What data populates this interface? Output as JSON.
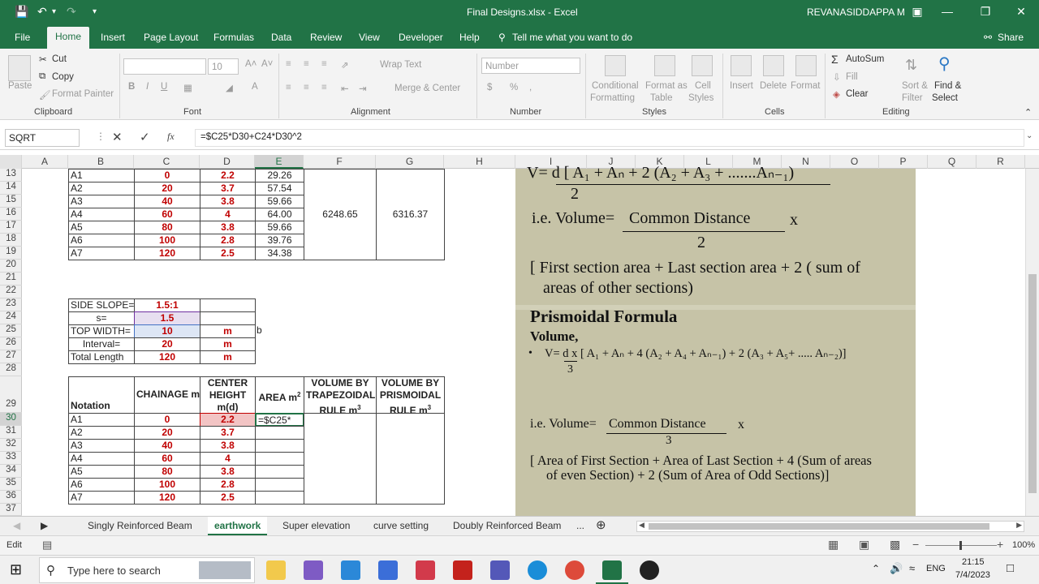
{
  "window": {
    "title": "Final Designs.xlsx  -  Excel",
    "user": "REVANASIDDAPPA M"
  },
  "ribbon_tabs": [
    "File",
    "Home",
    "Insert",
    "Page Layout",
    "Formulas",
    "Data",
    "Review",
    "View",
    "Developer",
    "Help"
  ],
  "tell_me": "Tell me what you want to do",
  "share": "Share",
  "clipboard": {
    "paste": "Paste",
    "cut": "Cut",
    "copy": "Copy",
    "format_painter": "Format Painter",
    "label": "Clipboard"
  },
  "font": {
    "size": "10",
    "label": "Font",
    "bold": "B",
    "italic": "I",
    "underline": "U"
  },
  "alignment": {
    "wrap": "Wrap Text",
    "merge": "Merge & Center",
    "label": "Alignment"
  },
  "number": {
    "format": "Number",
    "label": "Number",
    "currency": "$",
    "percent": "%",
    "comma": ","
  },
  "styles": {
    "cond": "Conditional",
    "cond2": "Formatting",
    "fmt_table": "Format as",
    "fmt_table2": "Table",
    "cell_styles": "Cell",
    "cell_styles2": "Styles",
    "label": "Styles"
  },
  "cells_group": {
    "insert": "Insert",
    "delete": "Delete",
    "format": "Format",
    "label": "Cells"
  },
  "editing": {
    "autosum": "AutoSum",
    "fill": "Fill",
    "clear": "Clear",
    "sort": "Sort &",
    "sort2": "Filter",
    "find": "Find &",
    "find2": "Select",
    "label": "Editing"
  },
  "formula_bar": {
    "name_box": "SQRT",
    "fx": "fx",
    "formula": "=$C25*D30+C24*D30^2"
  },
  "columns": [
    "A",
    "B",
    "C",
    "D",
    "E",
    "F",
    "G",
    "H",
    "I",
    "J",
    "K",
    "L",
    "M",
    "N",
    "O",
    "P",
    "Q",
    "R"
  ],
  "rows": [
    "13",
    "14",
    "15",
    "16",
    "17",
    "18",
    "19",
    "20",
    "21",
    "22",
    "23",
    "24",
    "25",
    "26",
    "27",
    "28",
    "29",
    "30",
    "31",
    "32",
    "33",
    "34",
    "35",
    "36",
    "37"
  ],
  "table1": {
    "rows": [
      {
        "b": "A1",
        "c": "0",
        "d": "2.2",
        "e": "29.26"
      },
      {
        "b": "A2",
        "c": "20",
        "d": "3.7",
        "e": "57.54"
      },
      {
        "b": "A3",
        "c": "40",
        "d": "3.8",
        "e": "59.66"
      },
      {
        "b": "A4",
        "c": "60",
        "d": "4",
        "e": "64.00"
      },
      {
        "b": "A5",
        "c": "80",
        "d": "3.8",
        "e": "59.66"
      },
      {
        "b": "A6",
        "c": "100",
        "d": "2.8",
        "e": "39.76"
      },
      {
        "b": "A7",
        "c": "120",
        "d": "2.5",
        "e": "34.38"
      }
    ],
    "f_total": "6248.65",
    "g_total": "6316.37"
  },
  "params": {
    "side_slope_label": "SIDE SLOPE=",
    "side_slope": "1.5:1",
    "s_label": "s=",
    "s": "1.5",
    "top_width_label": "TOP WIDTH=",
    "top_width": "10",
    "top_width_unit": "m",
    "h25": "b",
    "interval_label": "Interval=",
    "interval": "20",
    "interval_unit": "m",
    "total_length_label": "Total Length",
    "total_length": "120",
    "total_length_unit": "m"
  },
  "table2": {
    "headers": {
      "notation": "Notation",
      "chainage": "CHAINAGE m",
      "center_height": "CENTER HEIGHT m(d)",
      "area": "AREA m",
      "vol_trap": "VOLUME BY TRAPEZOIDAL RULE m",
      "vol_prism": "VOLUME BY PRISMOIDAL RULE m"
    },
    "rows": [
      {
        "b": "A1",
        "c": "0",
        "d": "2.2",
        "e": "=$C25*"
      },
      {
        "b": "A2",
        "c": "20",
        "d": "3.7",
        "e": ""
      },
      {
        "b": "A3",
        "c": "40",
        "d": "3.8",
        "e": ""
      },
      {
        "b": "A4",
        "c": "60",
        "d": "4",
        "e": ""
      },
      {
        "b": "A5",
        "c": "80",
        "d": "3.8",
        "e": ""
      },
      {
        "b": "A6",
        "c": "100",
        "d": "2.8",
        "e": ""
      },
      {
        "b": "A7",
        "c": "120",
        "d": "2.5",
        "e": ""
      }
    ]
  },
  "image_text": {
    "top_formula": "V= d [ A₁ + Aₙ + 2 (A₂ + A₃ + .......Aₙ₋₁)",
    "top_den": "2",
    "ie_volume": "i.e. Volume=",
    "common_distance": "Common Distance",
    "x": "x",
    "den2": "2",
    "first_section": "[ First section area + Last section area + 2 ( sum of",
    "first_section2": "areas of other sections)",
    "prismoidal": "Prismoidal Formula",
    "volume": "Volume,",
    "pformula": "V= d  x [ A₁ + Aₙ + 4 (A₂ + A₄ + Aₙ₋₁) + 2 (A₃ + A₅+ ..... Aₙ₋₂)]",
    "den3": "3",
    "ie_volume2": "i.e. Volume=",
    "common_distance2": "Common Distance",
    "x2": "x",
    "den3b": "3",
    "area_first": "[ Area of First Section + Area of Last Section + 4 (Sum of areas",
    "area_first2": "of even Section) + 2 (Sum of Area of Odd Sections)]"
  },
  "sheets": [
    "Singly Reinforced Beam",
    "earthwork",
    "Super elevation",
    "curve setting",
    "Doubly Reinforced Beam",
    "..."
  ],
  "status": {
    "mode": "Edit",
    "zoom": "100%"
  },
  "taskbar": {
    "search": "Type here to search",
    "time": "21:15",
    "date": "7/4/2023",
    "lang": "ENG"
  },
  "colors": {
    "excel_green": "#217346",
    "red_text": "#c00000",
    "image_bg": "#c6c3a7"
  }
}
